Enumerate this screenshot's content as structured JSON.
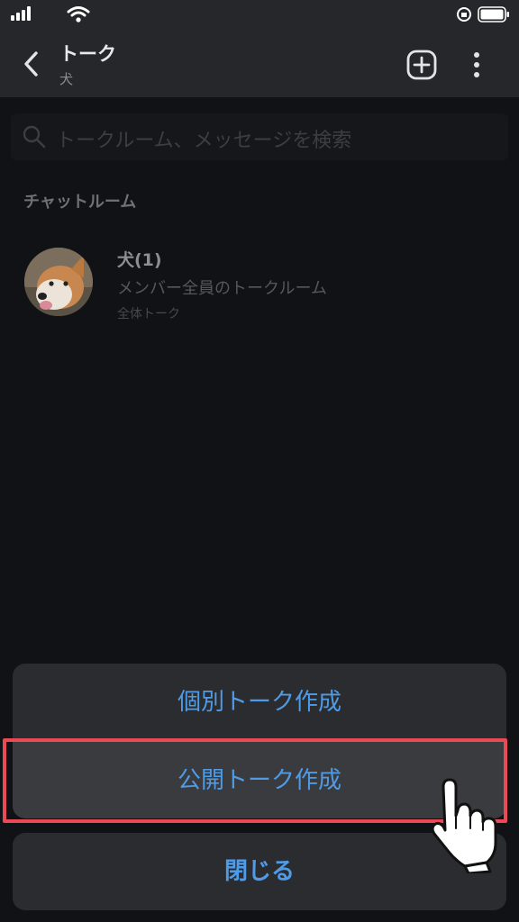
{
  "header": {
    "title": "トーク",
    "subtitle": "犬"
  },
  "search": {
    "placeholder": "トークルーム、メッセージを検索"
  },
  "section": {
    "label": "チャットルーム"
  },
  "rooms": [
    {
      "name": "犬(1)",
      "description": "メンバー全員のトークルーム",
      "tag": "全体トーク"
    }
  ],
  "action_sheet": {
    "items": [
      {
        "label": "個別トーク作成"
      },
      {
        "label": "公開トーク作成"
      }
    ],
    "close_label": "閉じる"
  },
  "colors": {
    "accent": "#4f9be6",
    "highlight": "#e94a55",
    "background": "#111215",
    "sheet": "#2b2c30"
  },
  "icons": [
    "signal-icon",
    "wifi-icon",
    "rotation-lock-icon",
    "battery-icon",
    "back-icon",
    "add-icon",
    "more-icon",
    "search-icon",
    "pointing-hand-icon"
  ]
}
